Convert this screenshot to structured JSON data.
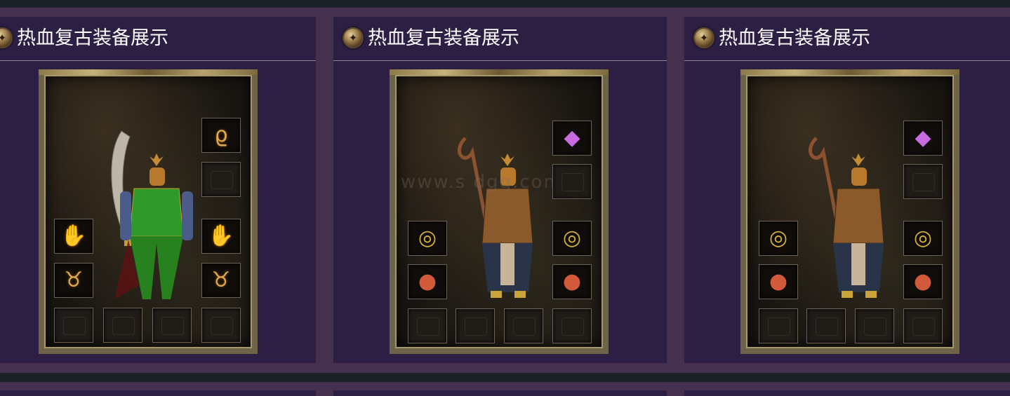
{
  "panels": [
    {
      "title": "热血复古装备展示",
      "image_alt": "warrior equipment",
      "weapon": "sword",
      "armor_color": "#2f9a2a",
      "top_slots": [
        "necklace-icon",
        "empty-slot"
      ],
      "mid_slots": [
        "bracelet-icon",
        "bracelet-icon"
      ],
      "ring_slots": [
        "ring-icon",
        "ring-icon"
      ]
    },
    {
      "title": "热血复古装备展示",
      "image_alt": "taoist equipment",
      "weapon": "staff",
      "armor_color": "#8a5a2a",
      "top_slots": [
        "gem-necklace-icon",
        "empty-slot"
      ],
      "mid_slots": [
        "jade-bracelet-icon",
        "jade-bracelet-icon"
      ],
      "ring_slots": [
        "ruby-ring-icon",
        "ruby-ring-icon"
      ],
      "watermark": "www.s  dgg.com"
    },
    {
      "title": "热血复古装备展示",
      "image_alt": "taoist equipment",
      "weapon": "staff",
      "armor_color": "#8a5a2a",
      "top_slots": [
        "gem-necklace-icon",
        "empty-slot"
      ],
      "mid_slots": [
        "jade-bracelet-icon",
        "jade-bracelet-icon"
      ],
      "ring_slots": [
        "ruby-ring-icon",
        "ruby-ring-icon"
      ]
    }
  ],
  "colors": {
    "page_bg": "#45304f",
    "panel_bg": "#2d1f43",
    "bar_bg": "#1d2229",
    "title_text": "#ffffff"
  }
}
